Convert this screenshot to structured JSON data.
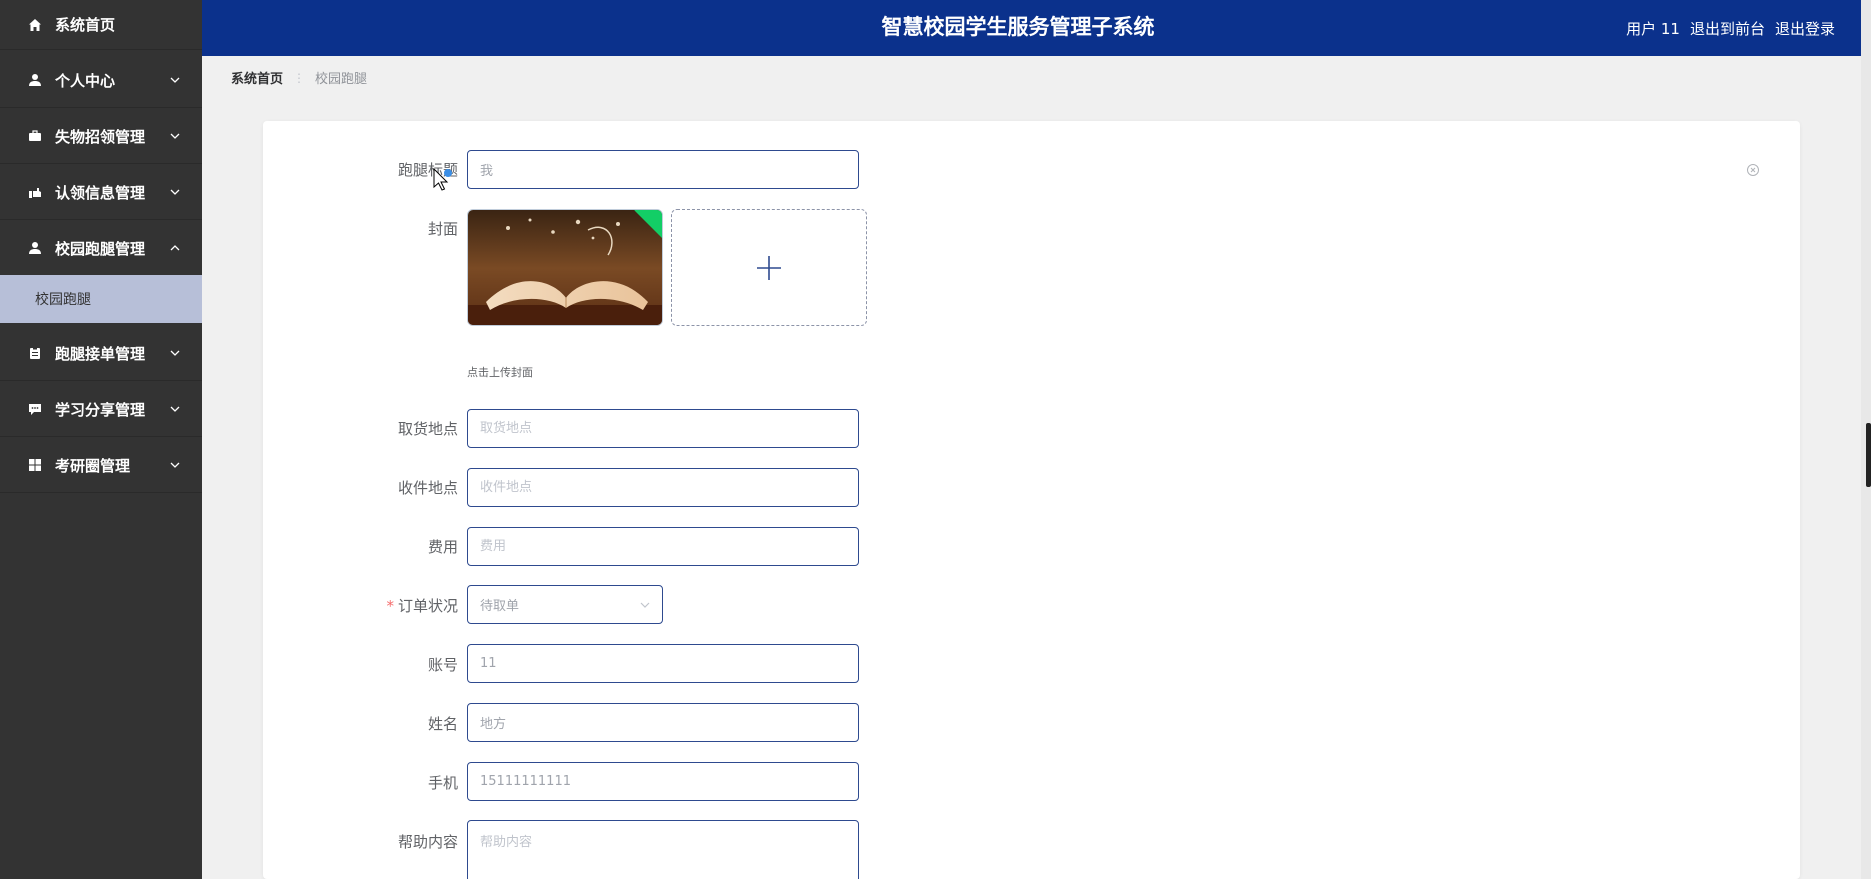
{
  "sidebar": {
    "home": "系统首页",
    "items": [
      {
        "label": "个人中心",
        "icon": "user-icon"
      },
      {
        "label": "失物招领管理",
        "icon": "briefcase-icon"
      },
      {
        "label": "认领信息管理",
        "icon": "hand-icon"
      },
      {
        "label": "校园跑腿管理",
        "icon": "user-icon",
        "expanded": true
      },
      {
        "label": "跑腿接单管理",
        "icon": "clipboard-icon"
      },
      {
        "label": "学习分享管理",
        "icon": "chat-icon"
      },
      {
        "label": "考研圈管理",
        "icon": "grid-icon"
      }
    ],
    "active_sub": "校园跑腿"
  },
  "header": {
    "title": "智慧校园学生服务管理子系统",
    "user": "用户 11",
    "to_front": "退出到前台",
    "logout": "退出登录"
  },
  "breadcrumb": {
    "home": "系统首页",
    "current": "校园跑腿"
  },
  "form": {
    "title_label": "跑腿标题",
    "title_value": "我",
    "cover_label": "封面",
    "cover_tip": "点击上传封面",
    "pickup_label": "取货地点",
    "pickup_placeholder": "取货地点",
    "receive_label": "收件地点",
    "receive_placeholder": "收件地点",
    "fee_label": "费用",
    "fee_placeholder": "费用",
    "status_required": "*",
    "status_label": "订单状况",
    "status_value": "待取单",
    "account_label": "账号",
    "account_value": "11",
    "name_label": "姓名",
    "name_value": "地方",
    "phone_label": "手机",
    "phone_value": "15111111111",
    "help_label": "帮助内容",
    "help_placeholder": "帮助内容"
  },
  "colors": {
    "header_bg": "#0b318c",
    "sidebar_bg": "#333333",
    "active_sub_bg": "#b7bfd8",
    "input_border": "#2e4a8f",
    "required": "#f56c6c",
    "upload_badge": "#13ce66"
  }
}
